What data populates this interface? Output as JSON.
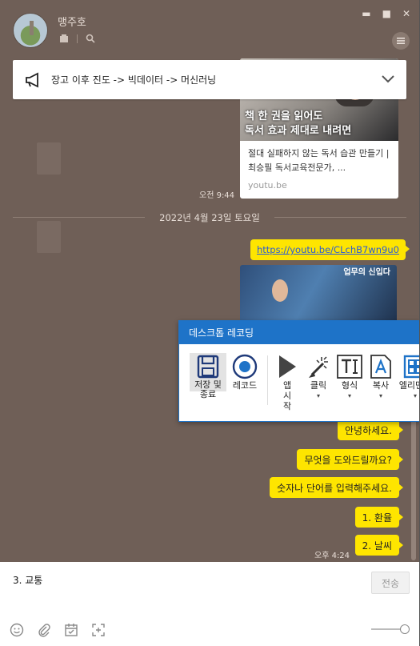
{
  "window": {
    "chat_name": "맹주호",
    "controls": {
      "minimize": "▬",
      "maximize": "■",
      "close": "✕"
    }
  },
  "notice": {
    "text": "장고 이후 진도 -> 빅데이터 -> 머신러닝"
  },
  "link_card": {
    "thumb_title_1": "책 한 권을 읽어도",
    "thumb_title_2": "독서 효과 제대로 내려면",
    "description": "절대 실패하지 않는 독서 습관 만들기 | 최승필 독서교육전문가, ...",
    "domain": "youtu.be",
    "time": "오전 9:44"
  },
  "date_separator": "2022년 4월 23일 토요일",
  "url_message": "https://youtu.be/CLchB7wn9u0",
  "video_thumb_label": "업무의 신입다",
  "recording": {
    "title": "데스크톱 레코딩",
    "tools": [
      {
        "label": "저장 및 종료",
        "icon": "save-icon"
      },
      {
        "label": "레코드",
        "icon": "record-icon"
      },
      {
        "label": "앱 시작",
        "icon": "play-icon"
      },
      {
        "label": "클릭",
        "icon": "click-icon"
      },
      {
        "label": "형식",
        "icon": "text-format-icon"
      },
      {
        "label": "복사",
        "icon": "copy-text-icon"
      },
      {
        "label": "엘리먼트",
        "icon": "element-icon"
      }
    ]
  },
  "messages": [
    {
      "text": "안녕하세요."
    },
    {
      "text": "무엇을 도와드릴까요?"
    },
    {
      "text": "숫자나 단어를 입력해주세요."
    },
    {
      "text": "1. 환율"
    },
    {
      "text": "2. 날씨"
    }
  ],
  "last_time": "오후 4:24",
  "input": {
    "value": "3. 교통",
    "send_label": "전송"
  },
  "colors": {
    "chat_bg": "#6f5f57",
    "bubble": "#fee500",
    "accent": "#1e73c8"
  }
}
